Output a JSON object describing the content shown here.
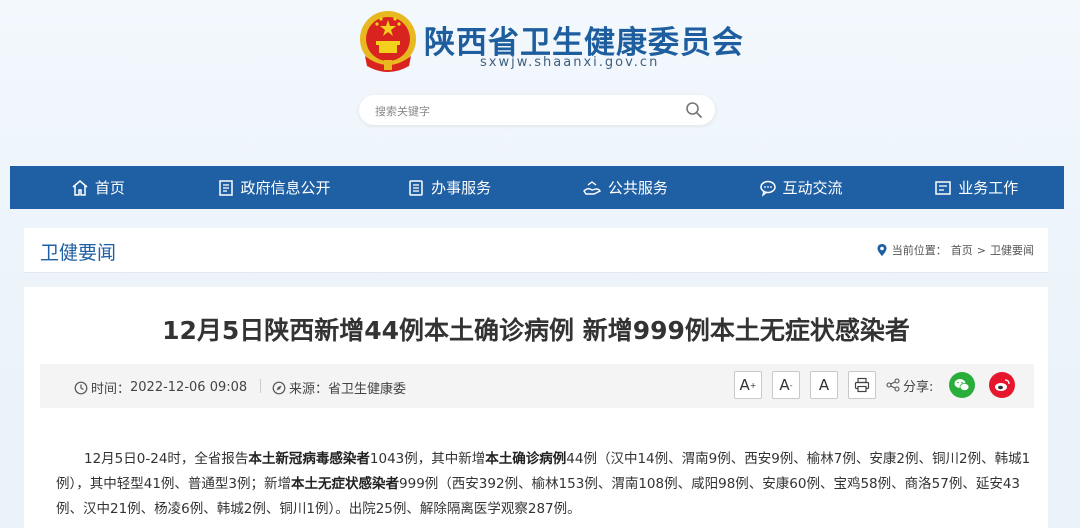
{
  "header": {
    "site_title": "陕西省卫生健康委员会",
    "site_domain": "sxwjw.shaanxi.gov.cn",
    "emblem_icon": "national-emblem",
    "search_placeholder": "搜索关键字"
  },
  "nav": {
    "items": [
      {
        "label": "首页",
        "icon": "home-icon"
      },
      {
        "label": "政府信息公开",
        "icon": "document-icon"
      },
      {
        "label": "办事服务",
        "icon": "list-icon"
      },
      {
        "label": "公共服务",
        "icon": "service-icon"
      },
      {
        "label": "互动交流",
        "icon": "chat-icon"
      },
      {
        "label": "业务工作",
        "icon": "work-icon"
      }
    ]
  },
  "section": {
    "title": "卫健要闻",
    "breadcrumb": {
      "prefix": "当前位置：",
      "home": "首页",
      "separator": ">",
      "current": "卫健要闻"
    }
  },
  "article": {
    "headline": "12月5日陕西新增44例本土确诊病例 新增999例本土无症状感染者",
    "meta": {
      "time_label": "时间：",
      "time_value": "2022-12-06 09:08",
      "source_label": "来源：",
      "source_value": "省卫生健康委"
    },
    "tools": {
      "font_larger": "A",
      "font_smaller": "A",
      "font_normal": "A",
      "share_label": "分享:"
    },
    "body": {
      "p1_a": "12月5日0-24时，全省报告",
      "p1_b": "本土新冠病毒感染者",
      "p1_c": "1043例，其中新增",
      "p1_d": "本土确诊病例",
      "p1_e": "44例（汉中14例、渭南9例、西安9例、榆林7例、安康2例、铜川2例、韩城1例），其中轻型41例、普通型3例；新增",
      "p1_f": "本土无症状感染者",
      "p1_g": "999例（西安392例、榆林153例、渭南108例、咸阳98例、安康60例、宝鸡58例、商洛57例、延安43例、汉中21例、杨凌6例、韩城2例、铜川1例）。出院25例、解除隔离医学观察287例。"
    },
    "colors": {
      "brand_blue": "#1f5fa3",
      "wechat_green": "#2aae3b",
      "weibo_red": "#e6162d"
    }
  }
}
